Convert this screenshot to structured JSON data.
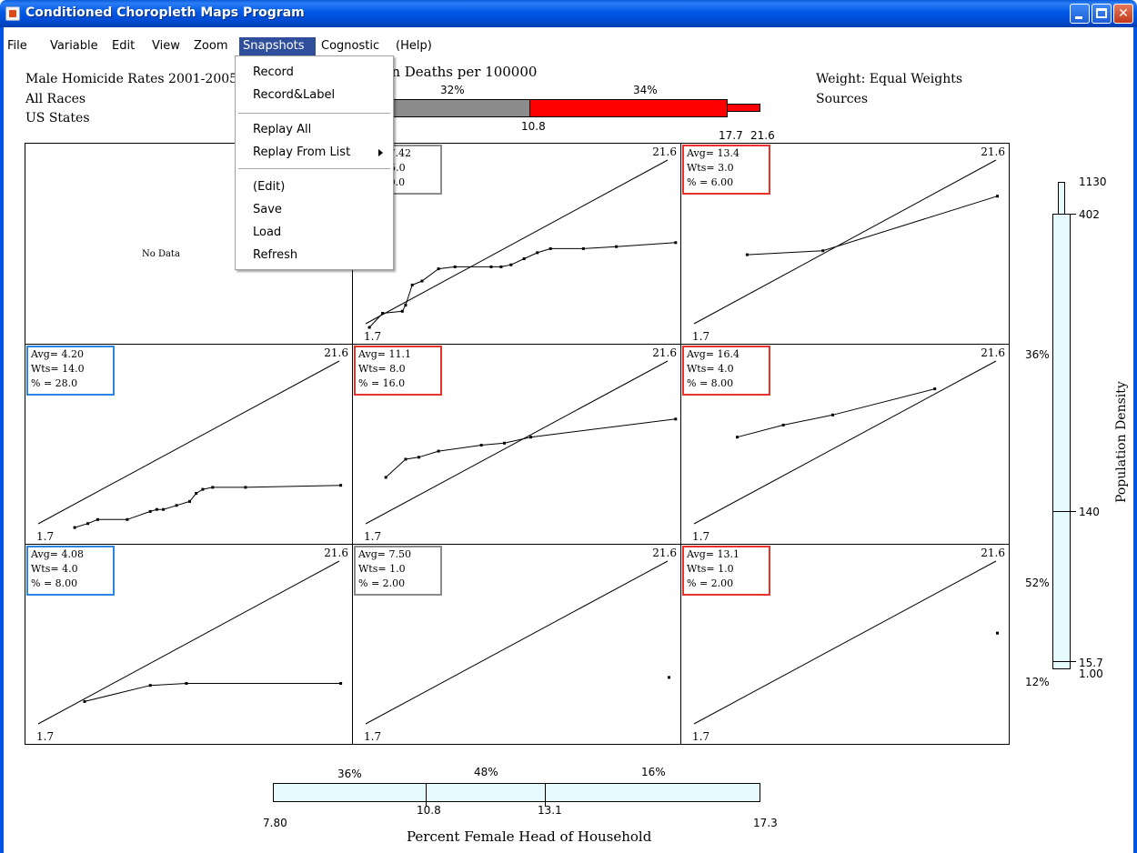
{
  "window": {
    "title": "Conditioned Choropleth Maps Program"
  },
  "menu": {
    "items": [
      "File",
      "Variable",
      "Edit",
      "View",
      "Zoom",
      "Snapshots",
      "Cognostic",
      "(Help)"
    ],
    "active": "Snapshots"
  },
  "snapshots_menu": {
    "items": [
      "Record",
      "Record&Label",
      "Replay All",
      "Replay From List",
      "(Edit)",
      "Save",
      "Load",
      "Refresh"
    ]
  },
  "header": {
    "left": [
      "Male Homicide Rates 2001-2005",
      "All Races",
      "US States"
    ],
    "right": [
      "Weight: Equal Weights",
      "Sources"
    ],
    "title": "Homicide Rates in Deaths per 100000"
  },
  "top_slider": {
    "percents": [
      "32%",
      "34%"
    ],
    "tick_labels": [
      "10.8",
      "17.7",
      "21.6"
    ],
    "colors": {
      "middle": "#8c8c8c",
      "upper": "#ff0000"
    }
  },
  "panels": [
    {
      "row": 1,
      "col": 1,
      "no_data": "No Data"
    },
    {
      "row": 1,
      "col": 2,
      "avg": "Avg= 7.42",
      "wts": "Wts= 5.0",
      "pct": "% = 10.0",
      "box_color": "#8c8c8c",
      "max": "21.6",
      "min": "1.7",
      "points": [
        [
          0.05,
          0.91
        ],
        [
          0.09,
          0.84
        ],
        [
          0.15,
          0.83
        ],
        [
          0.16,
          0.8
        ],
        [
          0.18,
          0.7
        ],
        [
          0.21,
          0.68
        ],
        [
          0.26,
          0.62
        ],
        [
          0.31,
          0.61
        ],
        [
          0.42,
          0.61
        ],
        [
          0.45,
          0.61
        ],
        [
          0.48,
          0.6
        ],
        [
          0.52,
          0.57
        ],
        [
          0.56,
          0.54
        ],
        [
          0.6,
          0.52
        ],
        [
          0.7,
          0.52
        ],
        [
          0.8,
          0.51
        ],
        [
          0.98,
          0.49
        ]
      ]
    },
    {
      "row": 1,
      "col": 3,
      "avg": "Avg= 13.4",
      "wts": "Wts= 3.0",
      "pct": "% = 6.00",
      "box_color": "#e8322a",
      "max": "21.6",
      "min": "1.7",
      "points": [
        [
          0.2,
          0.55
        ],
        [
          0.43,
          0.53
        ],
        [
          0.96,
          0.26
        ]
      ]
    },
    {
      "row": 2,
      "col": 1,
      "avg": "Avg= 4.20",
      "wts": "Wts= 14.0",
      "pct": "% = 28.0",
      "box_color": "#2a86e0",
      "max": "21.6",
      "min": "1.7",
      "points": [
        [
          0.15,
          0.91
        ],
        [
          0.19,
          0.89
        ],
        [
          0.22,
          0.87
        ],
        [
          0.31,
          0.87
        ],
        [
          0.38,
          0.83
        ],
        [
          0.4,
          0.82
        ],
        [
          0.42,
          0.82
        ],
        [
          0.46,
          0.8
        ],
        [
          0.5,
          0.78
        ],
        [
          0.52,
          0.74
        ],
        [
          0.54,
          0.72
        ],
        [
          0.57,
          0.71
        ],
        [
          0.67,
          0.71
        ],
        [
          0.96,
          0.7
        ]
      ]
    },
    {
      "row": 2,
      "col": 2,
      "avg": "Avg= 11.1",
      "wts": "Wts= 8.0",
      "pct": "% = 16.0",
      "box_color": "#e8322a",
      "max": "21.6",
      "min": "1.7",
      "points": [
        [
          0.1,
          0.66
        ],
        [
          0.16,
          0.57
        ],
        [
          0.2,
          0.56
        ],
        [
          0.26,
          0.53
        ],
        [
          0.39,
          0.5
        ],
        [
          0.46,
          0.49
        ],
        [
          0.54,
          0.46
        ],
        [
          0.98,
          0.37
        ]
      ]
    },
    {
      "row": 2,
      "col": 3,
      "avg": "Avg= 16.4",
      "wts": "Wts= 4.0",
      "pct": "% = 8.00",
      "box_color": "#e8322a",
      "max": "21.6",
      "min": "1.7",
      "points": [
        [
          0.17,
          0.46
        ],
        [
          0.31,
          0.4
        ],
        [
          0.46,
          0.35
        ],
        [
          0.77,
          0.22
        ]
      ]
    },
    {
      "row": 3,
      "col": 1,
      "avg": "Avg= 4.08",
      "wts": "Wts= 4.0",
      "pct": "% = 8.00",
      "box_color": "#2a86e0",
      "max": "21.6",
      "min": "1.7",
      "points": [
        [
          0.18,
          0.78
        ],
        [
          0.38,
          0.7
        ],
        [
          0.49,
          0.69
        ],
        [
          0.96,
          0.69
        ]
      ]
    },
    {
      "row": 3,
      "col": 2,
      "avg": "Avg= 7.50",
      "wts": "Wts= 1.0",
      "pct": "% = 2.00",
      "box_color": "#8c8c8c",
      "max": "21.6",
      "min": "1.7",
      "points": [
        [
          0.96,
          0.66
        ]
      ]
    },
    {
      "row": 3,
      "col": 3,
      "avg": "Avg= 13.1",
      "wts": "Wts= 1.0",
      "pct": "% = 2.00",
      "box_color": "#e8322a",
      "max": "21.6",
      "min": "1.7",
      "points": [
        [
          0.96,
          0.44
        ]
      ]
    }
  ],
  "right_slider": {
    "label": "Population Density",
    "tick_labels": [
      "1130",
      "402",
      "140",
      "15.7",
      "1.00"
    ],
    "percents": [
      "36%",
      "52%",
      "12%"
    ],
    "color": "#e6fbfd"
  },
  "bottom_slider": {
    "label": "Percent Female Head of Household",
    "tick_labels": [
      "7.80",
      "10.8",
      "13.1",
      "17.3"
    ],
    "percents": [
      "36%",
      "48%",
      "16%"
    ],
    "color": "#e6fbfd"
  }
}
